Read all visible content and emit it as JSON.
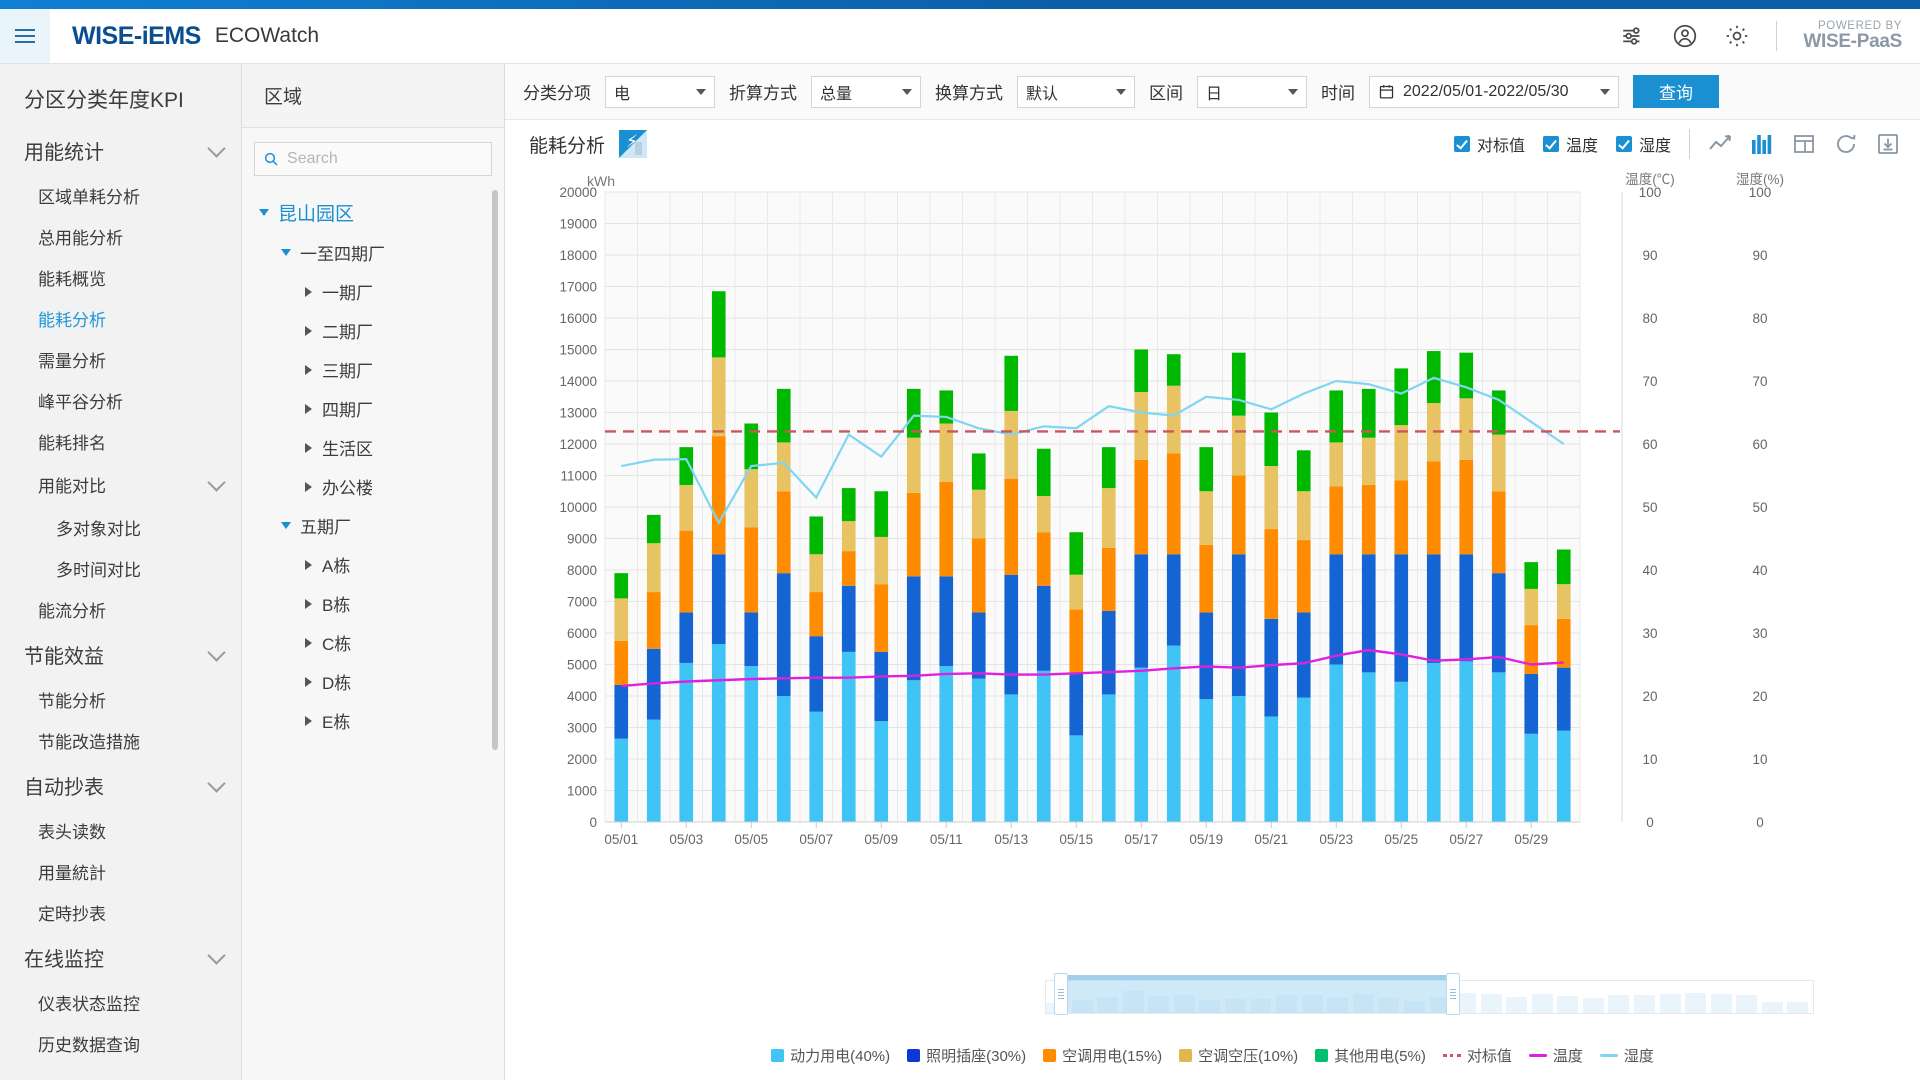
{
  "header": {
    "brand": "WISE-iEMS",
    "app_name": "ECOWatch",
    "menu_icon": "hamburger-icon",
    "filter_icon": "sliders-icon",
    "account_icon": "user-circle-icon",
    "settings_icon": "gear-icon",
    "powered_by_top": "POWERED BY",
    "powered_by_bottom": "WISE-PaaS"
  },
  "sidebar": {
    "title": "分区分类年度KPI",
    "groups": [
      {
        "label": "用能统计",
        "items": [
          {
            "label": "区域单耗分析",
            "active": false,
            "sub": false
          },
          {
            "label": "总用能分析",
            "active": false,
            "sub": false
          },
          {
            "label": "能耗概览",
            "active": false,
            "sub": false
          },
          {
            "label": "能耗分析",
            "active": true,
            "sub": false
          },
          {
            "label": "需量分析",
            "active": false,
            "sub": false
          },
          {
            "label": "峰平谷分析",
            "active": false,
            "sub": false
          },
          {
            "label": "能耗排名",
            "active": false,
            "sub": false
          }
        ],
        "subgroup": {
          "label": "用能对比",
          "items": [
            {
              "label": "多对象对比"
            },
            {
              "label": "多时间对比"
            }
          ]
        },
        "after_items": [
          {
            "label": "能流分析",
            "active": false,
            "sub": false
          }
        ]
      },
      {
        "label": "节能效益",
        "items": [
          {
            "label": "节能分析",
            "active": false,
            "sub": false
          },
          {
            "label": "节能改造措施",
            "active": false,
            "sub": false
          }
        ]
      },
      {
        "label": "自动抄表",
        "items": [
          {
            "label": "表头读数",
            "active": false,
            "sub": false
          },
          {
            "label": "用量統計",
            "active": false,
            "sub": false
          },
          {
            "label": "定時抄表",
            "active": false,
            "sub": false
          }
        ]
      },
      {
        "label": "在线监控",
        "items": [
          {
            "label": "仪表状态监控",
            "active": false,
            "sub": false
          },
          {
            "label": "历史数据查询",
            "active": false,
            "sub": false
          }
        ]
      }
    ]
  },
  "tree_panel": {
    "title": "区域",
    "search_placeholder": "Search",
    "search_value": "",
    "search_icon": "search-icon",
    "nodes": [
      {
        "label": "昆山园区",
        "depth": 0,
        "expanded": true,
        "selected": true
      },
      {
        "label": "一至四期厂",
        "depth": 1,
        "expanded": true,
        "selected": false
      },
      {
        "label": "一期厂",
        "depth": 2,
        "expanded": false,
        "selected": false
      },
      {
        "label": "二期厂",
        "depth": 2,
        "expanded": false,
        "selected": false
      },
      {
        "label": "三期厂",
        "depth": 2,
        "expanded": false,
        "selected": false
      },
      {
        "label": "四期厂",
        "depth": 2,
        "expanded": false,
        "selected": false
      },
      {
        "label": "生活区",
        "depth": 2,
        "expanded": false,
        "selected": false
      },
      {
        "label": "办公楼",
        "depth": 2,
        "expanded": false,
        "selected": false
      },
      {
        "label": "五期厂",
        "depth": 1,
        "expanded": true,
        "selected": false
      },
      {
        "label": "A栋",
        "depth": 2,
        "expanded": false,
        "selected": false
      },
      {
        "label": "B栋",
        "depth": 2,
        "expanded": false,
        "selected": false
      },
      {
        "label": "C栋",
        "depth": 2,
        "expanded": false,
        "selected": false
      },
      {
        "label": "D栋",
        "depth": 2,
        "expanded": false,
        "selected": false
      },
      {
        "label": "E栋",
        "depth": 2,
        "expanded": false,
        "selected": false
      }
    ]
  },
  "filterbar": {
    "category_label": "分类分项",
    "category_value": "电",
    "convert_label": "折算方式",
    "convert_value": "总量",
    "unit_label": "换算方式",
    "unit_value": "默认",
    "interval_label": "区间",
    "interval_value": "日",
    "time_label": "时间",
    "time_value": "2022/05/01-2022/05/30",
    "calendar_icon": "calendar-icon",
    "query_button": "查询"
  },
  "chart_header": {
    "title": "能耗分析",
    "badge_icon": "electricity-meter-icon",
    "checkboxes": [
      {
        "label": "对标值",
        "checked": true
      },
      {
        "label": "温度",
        "checked": true
      },
      {
        "label": "湿度",
        "checked": true
      }
    ],
    "tool_icons": [
      {
        "name": "line-chart-icon",
        "active": false
      },
      {
        "name": "bar-chart-icon",
        "active": true
      },
      {
        "name": "table-icon",
        "active": false
      },
      {
        "name": "refresh-icon",
        "active": false
      },
      {
        "name": "download-icon",
        "active": false
      }
    ]
  },
  "chart_data": {
    "type": "bar",
    "title": "能耗分析",
    "ylabel": "kWh",
    "y2label": "温度(℃)",
    "y3label": "湿度(%)",
    "ylim": [
      0,
      20000
    ],
    "y2lim": [
      0,
      100
    ],
    "y3lim": [
      0,
      100
    ],
    "yticks": [
      0,
      1000,
      2000,
      3000,
      4000,
      5000,
      6000,
      7000,
      8000,
      9000,
      10000,
      11000,
      12000,
      13000,
      14000,
      15000,
      16000,
      17000,
      18000,
      19000,
      20000
    ],
    "y2ticks": [
      0,
      10,
      20,
      30,
      40,
      50,
      60,
      70,
      80,
      90,
      100
    ],
    "grid": true,
    "legend_position": "bottom",
    "colors": {
      "power": "#40C4F5",
      "lighting": "#1464D4",
      "hvac": "#FF8C00",
      "hvac_press": "#E8C364",
      "other": "#00B800",
      "benchmark": "#CC5560",
      "temperature": "#E020E0",
      "humidity": "#7FD5F2"
    },
    "categories": [
      "05/01",
      "05/02",
      "05/03",
      "05/04",
      "05/05",
      "05/06",
      "05/07",
      "05/08",
      "05/09",
      "05/10",
      "05/11",
      "05/12",
      "05/13",
      "05/14",
      "05/15",
      "05/16",
      "05/17",
      "05/18",
      "05/19",
      "05/20",
      "05/21",
      "05/22",
      "05/23",
      "05/24",
      "05/25",
      "05/26",
      "05/27",
      "05/28",
      "05/29",
      "05/30"
    ],
    "xtick_labels": [
      "05/01",
      "05/03",
      "05/05",
      "05/07",
      "05/09",
      "05/11",
      "05/13",
      "05/15",
      "05/17",
      "05/19",
      "05/21",
      "05/23",
      "05/25",
      "05/27",
      "05/29"
    ],
    "series": [
      {
        "name": "动力用电(40%)",
        "color": "#40C4F5",
        "values": [
          2650,
          3250,
          5050,
          5650,
          4950,
          4000,
          3500,
          5400,
          3200,
          4500,
          4950,
          4550,
          4050,
          4800,
          2750,
          4050,
          4900,
          5600,
          3900,
          4000,
          3350,
          3950,
          5000,
          4750,
          4450,
          5050,
          5100,
          4750,
          2800,
          2900
        ]
      },
      {
        "name": "照明插座(30%)",
        "color": "#1464D4",
        "values": [
          1700,
          2250,
          1600,
          2850,
          1700,
          3900,
          2400,
          2100,
          2200,
          3300,
          2850,
          2100,
          3800,
          2700,
          1950,
          2650,
          3600,
          2900,
          2750,
          4500,
          3100,
          2700,
          3500,
          3750,
          4050,
          3450,
          3400,
          3150,
          1900,
          2000
        ]
      },
      {
        "name": "空调用电(15%)",
        "color": "#FF8C00",
        "values": [
          1400,
          1800,
          2600,
          3750,
          2700,
          2600,
          1400,
          1100,
          2150,
          2650,
          3000,
          2350,
          3050,
          1700,
          2050,
          2000,
          3000,
          3200,
          2150,
          2500,
          2850,
          2300,
          2150,
          2200,
          2350,
          2950,
          3000,
          2600,
          1550,
          1550
        ]
      },
      {
        "name": "空调空压(10%)",
        "color": "#E8C364",
        "values": [
          1350,
          1550,
          1450,
          2500,
          1850,
          1550,
          1200,
          950,
          1500,
          1750,
          1850,
          1550,
          2150,
          1150,
          1100,
          1900,
          2150,
          2150,
          1700,
          1900,
          2000,
          1550,
          1400,
          1500,
          1750,
          1850,
          1950,
          1800,
          1150,
          1100
        ]
      },
      {
        "name": "其他用电(5%)",
        "color": "#00B800",
        "values": [
          800,
          900,
          1200,
          2100,
          1450,
          1700,
          1200,
          1050,
          1450,
          1550,
          1050,
          1150,
          1750,
          1500,
          1350,
          1300,
          1350,
          1000,
          1400,
          2000,
          1700,
          1300,
          1650,
          1550,
          1800,
          1650,
          1450,
          1400,
          850,
          1100
        ]
      }
    ],
    "benchmark": {
      "name": "对标值",
      "color": "#CC5560",
      "value": 12400,
      "style": "dashed"
    },
    "temperature": {
      "name": "温度",
      "color": "#E020E0",
      "unit": "℃",
      "values": [
        21.6,
        22.0,
        22.3,
        22.5,
        22.7,
        22.8,
        22.9,
        22.9,
        23.1,
        23.2,
        23.5,
        23.6,
        23.4,
        23.4,
        23.6,
        23.8,
        24.0,
        24.4,
        24.7,
        24.5,
        24.9,
        25.2,
        26.4,
        27.3,
        26.6,
        25.6,
        25.8,
        26.2,
        25.0,
        25.3
      ]
    },
    "humidity": {
      "name": "湿度",
      "color": "#7FD5F2",
      "unit": "%",
      "values": [
        56.5,
        57.5,
        57.6,
        47.5,
        56.5,
        57.0,
        51.5,
        61.5,
        58.0,
        64.5,
        64.3,
        62.5,
        61.5,
        62.8,
        62.5,
        66.0,
        65.0,
        64.5,
        67.5,
        67.0,
        65.5,
        68.0,
        70.0,
        69.5,
        68.0,
        70.5,
        69.0,
        67.0,
        63.5,
        60.0
      ]
    }
  },
  "zoom_slider": {
    "start_pct": 2,
    "end_pct": 53,
    "handle_left_name": "zoom-handle-left",
    "handle_right_name": "zoom-handle-right"
  },
  "legend": [
    {
      "label": "动力用电(40%)",
      "color": "#40C4F5",
      "kind": "swatch"
    },
    {
      "label": "照明插座(30%)",
      "color": "#0B38D6",
      "kind": "swatch"
    },
    {
      "label": "空调用电(15%)",
      "color": "#FF8C00",
      "kind": "swatch"
    },
    {
      "label": "空调空压(10%)",
      "color": "#E0B84E",
      "kind": "swatch"
    },
    {
      "label": "其他用电(5%)",
      "color": "#00C070",
      "kind": "swatch"
    },
    {
      "label": "对标值",
      "color": "#CC5560",
      "kind": "dash"
    },
    {
      "label": "温度",
      "color": "#E020E0",
      "kind": "line"
    },
    {
      "label": "湿度",
      "color": "#7FD5F2",
      "kind": "line"
    }
  ]
}
